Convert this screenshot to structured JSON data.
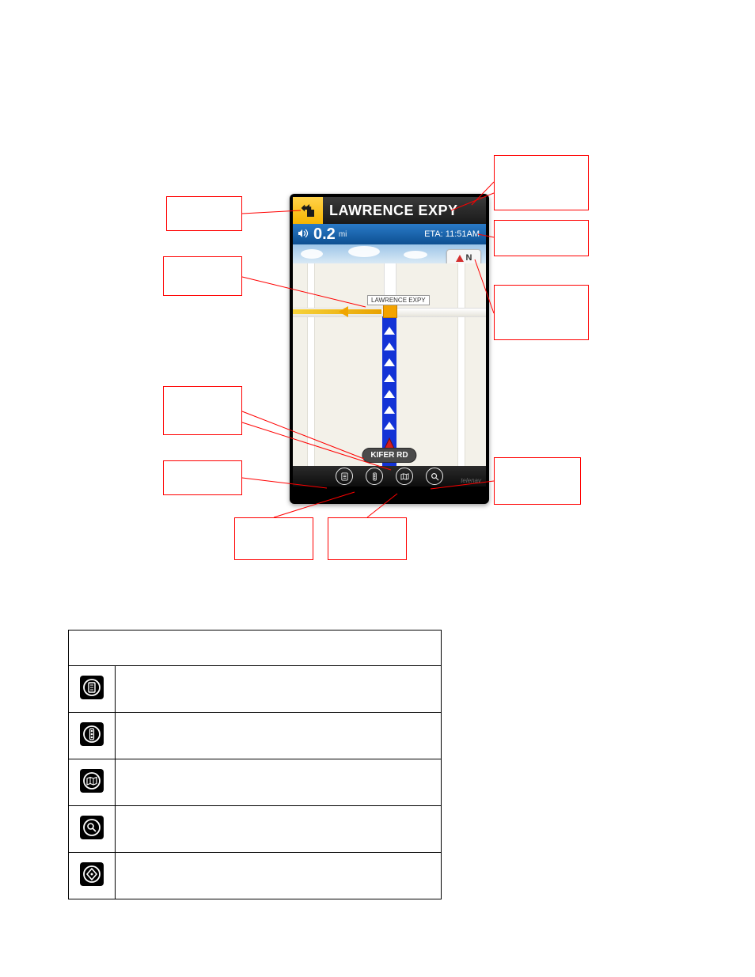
{
  "nav": {
    "next_turn_road": "LAWRENCE EXPY",
    "distance_value": "0.2",
    "distance_unit": "mi",
    "eta_label": "ETA: 11:51AM",
    "compass_label": "N",
    "map_label_intersection": "LAWRENCE EXPY",
    "current_road": "KIFER RD",
    "brand": "telenav"
  },
  "callouts": {
    "left1": "",
    "left2": "",
    "left3": "",
    "left4": "",
    "right1": "",
    "right2": "",
    "right3": "",
    "right4": "",
    "bottom1": "",
    "bottom2": ""
  },
  "icon_table": {
    "header": "",
    "rows": [
      {
        "icon": "route-summary-icon",
        "desc": ""
      },
      {
        "icon": "traffic-icon",
        "desc": ""
      },
      {
        "icon": "map-view-icon",
        "desc": ""
      },
      {
        "icon": "search-icon",
        "desc": ""
      },
      {
        "icon": "end-trip-icon",
        "desc": ""
      }
    ]
  }
}
